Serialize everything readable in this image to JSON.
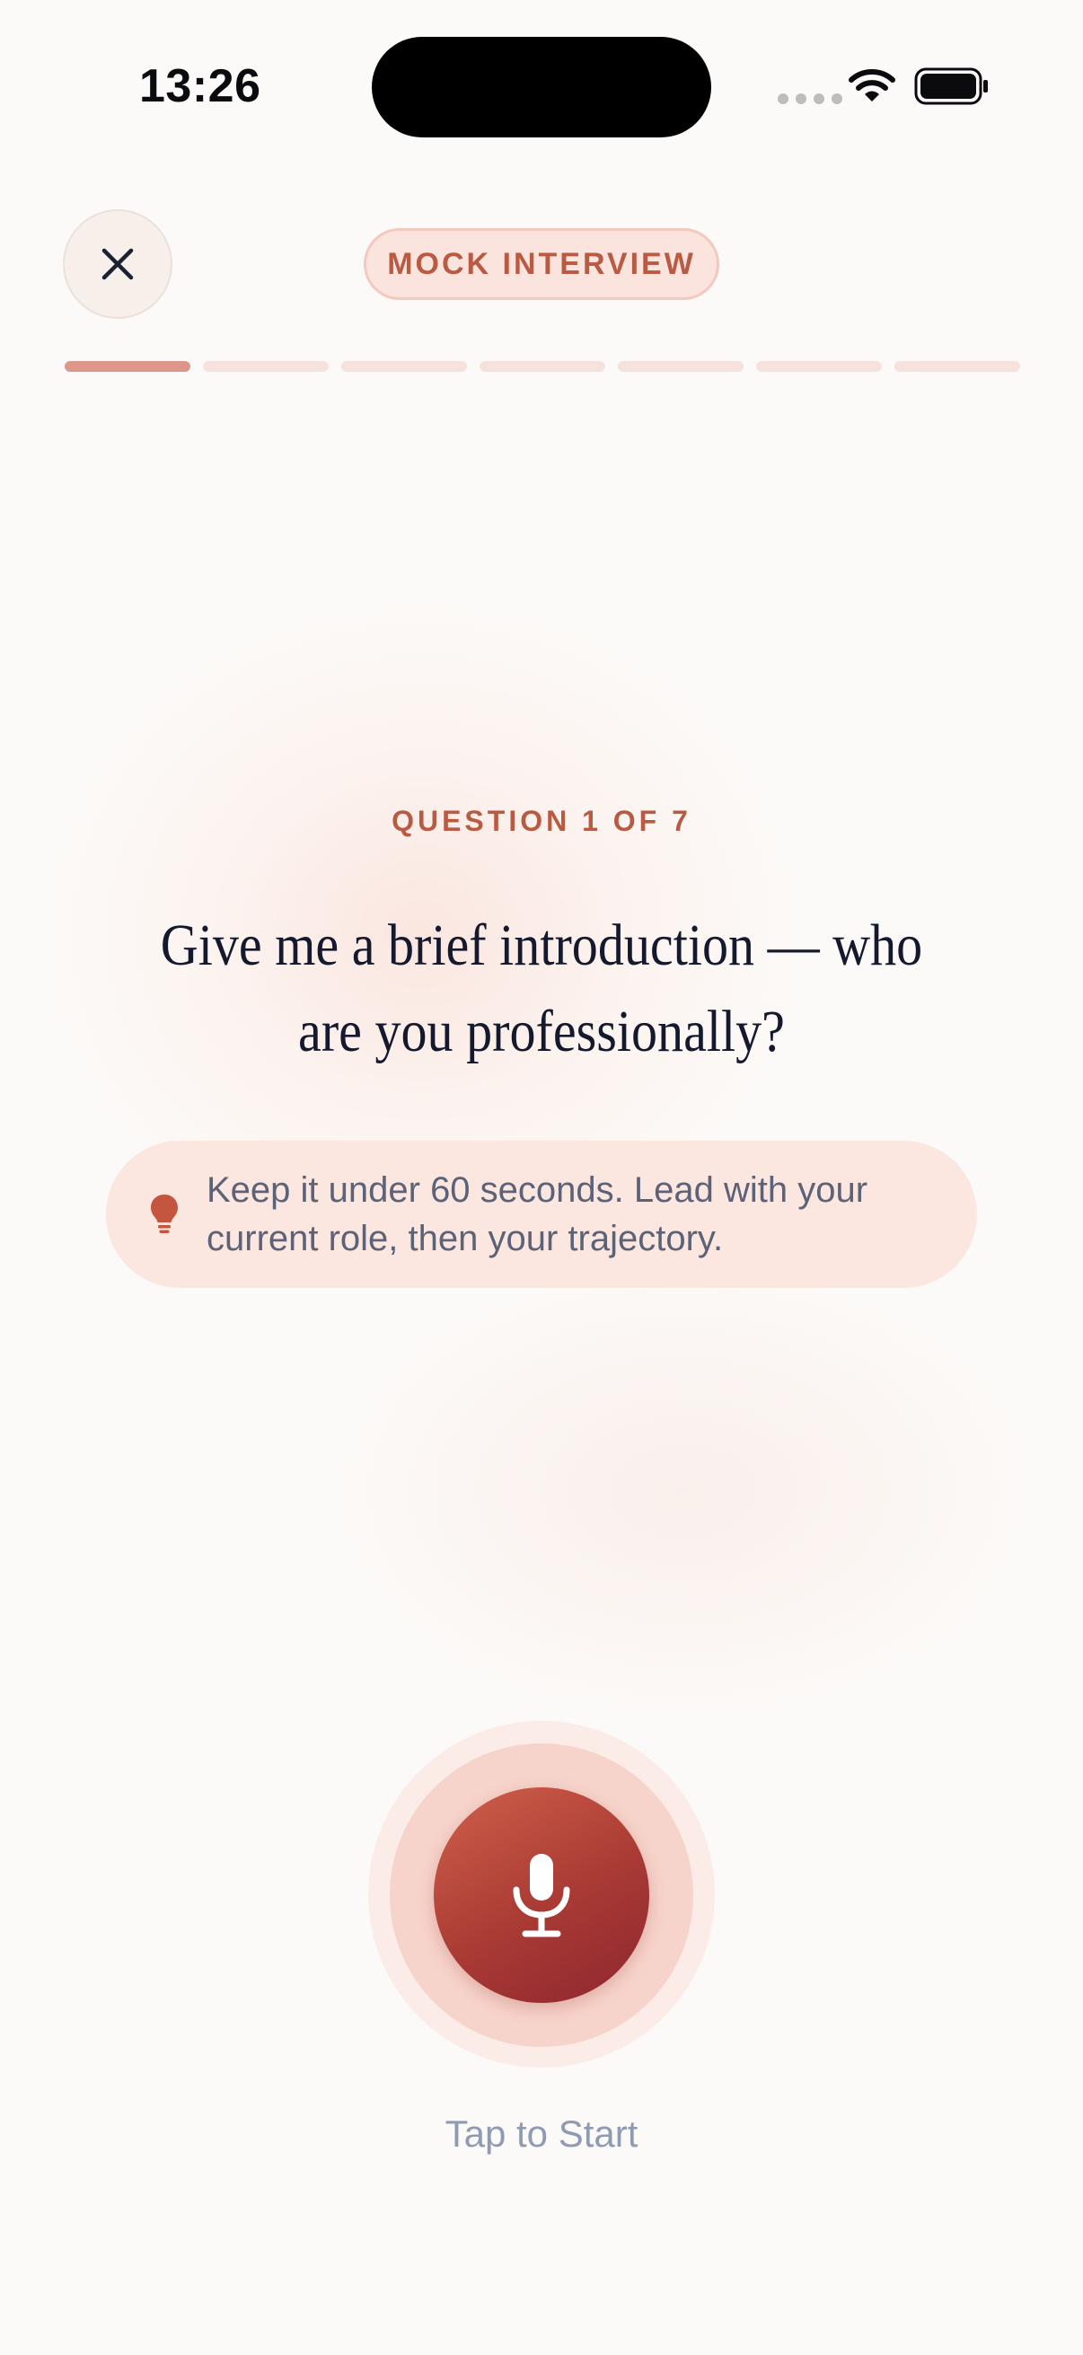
{
  "status_bar": {
    "time": "13:26"
  },
  "header": {
    "close_icon": "close-icon",
    "mode_label": "MOCK INTERVIEW"
  },
  "progress": {
    "total_steps": 7,
    "current_step": 1
  },
  "question": {
    "label": "QUESTION 1 OF 7",
    "text": "Give me a brief introduction — who are you professionally?"
  },
  "tip": {
    "icon": "lightbulb-icon",
    "text": "Keep it under 60 seconds. Lead with your current role, then your trajectory."
  },
  "recorder": {
    "icon": "microphone-icon",
    "label": "Tap to Start"
  },
  "colors": {
    "accent": "#b95a43",
    "progress_active": "#dc978a",
    "progress_inactive": "#f6e2dd",
    "mic_start": "#d0604a",
    "mic_end": "#8e2630",
    "background": "#fcfaf8"
  }
}
